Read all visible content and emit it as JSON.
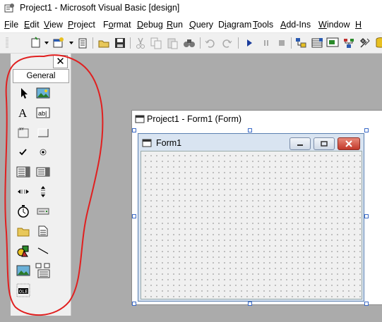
{
  "window": {
    "title": "Project1 - Microsoft Visual Basic [design]"
  },
  "menu": [
    {
      "label": "File",
      "underline": "F",
      "rest": "ile"
    },
    {
      "label": "Edit",
      "underline": "E",
      "rest": "dit"
    },
    {
      "label": "View",
      "underline": "V",
      "rest": "iew"
    },
    {
      "label": "Project",
      "underline": "P",
      "rest": "roject"
    },
    {
      "label": "Format",
      "underline": "o",
      "pre": "F",
      "rest": "rmat"
    },
    {
      "label": "Debug",
      "underline": "D",
      "rest": "ebug"
    },
    {
      "label": "Run",
      "underline": "R",
      "rest": "un"
    },
    {
      "label": "Query",
      "underline": "Q",
      "rest": "uery"
    },
    {
      "label": "Diagram",
      "underline": "i",
      "pre": "D",
      "rest": "agram"
    },
    {
      "label": "Tools",
      "underline": "T",
      "rest": "ools"
    },
    {
      "label": "Add-Ins",
      "underline": "A",
      "rest": "dd-Ins"
    },
    {
      "label": "Window",
      "underline": "W",
      "rest": "indow"
    },
    {
      "label": "H",
      "underline": "H",
      "rest": ""
    }
  ],
  "toolbox": {
    "close_label": "✕",
    "tab_label": "General",
    "tools": [
      "pointer",
      "picturebox",
      "label",
      "textbox",
      "frame",
      "commandbutton",
      "checkbox",
      "optionbutton",
      "combobox",
      "listbox",
      "hscrollbar",
      "vscrollbar",
      "timer",
      "drivelistbox",
      "dirlistbox",
      "filelistbox",
      "shape",
      "line",
      "image",
      "data",
      "ole"
    ]
  },
  "designer": {
    "title": "Project1 - Form1 (Form)"
  },
  "form": {
    "caption": "Form1"
  },
  "colors": {
    "annotation": "#e02020",
    "workspace": "#ababab"
  }
}
